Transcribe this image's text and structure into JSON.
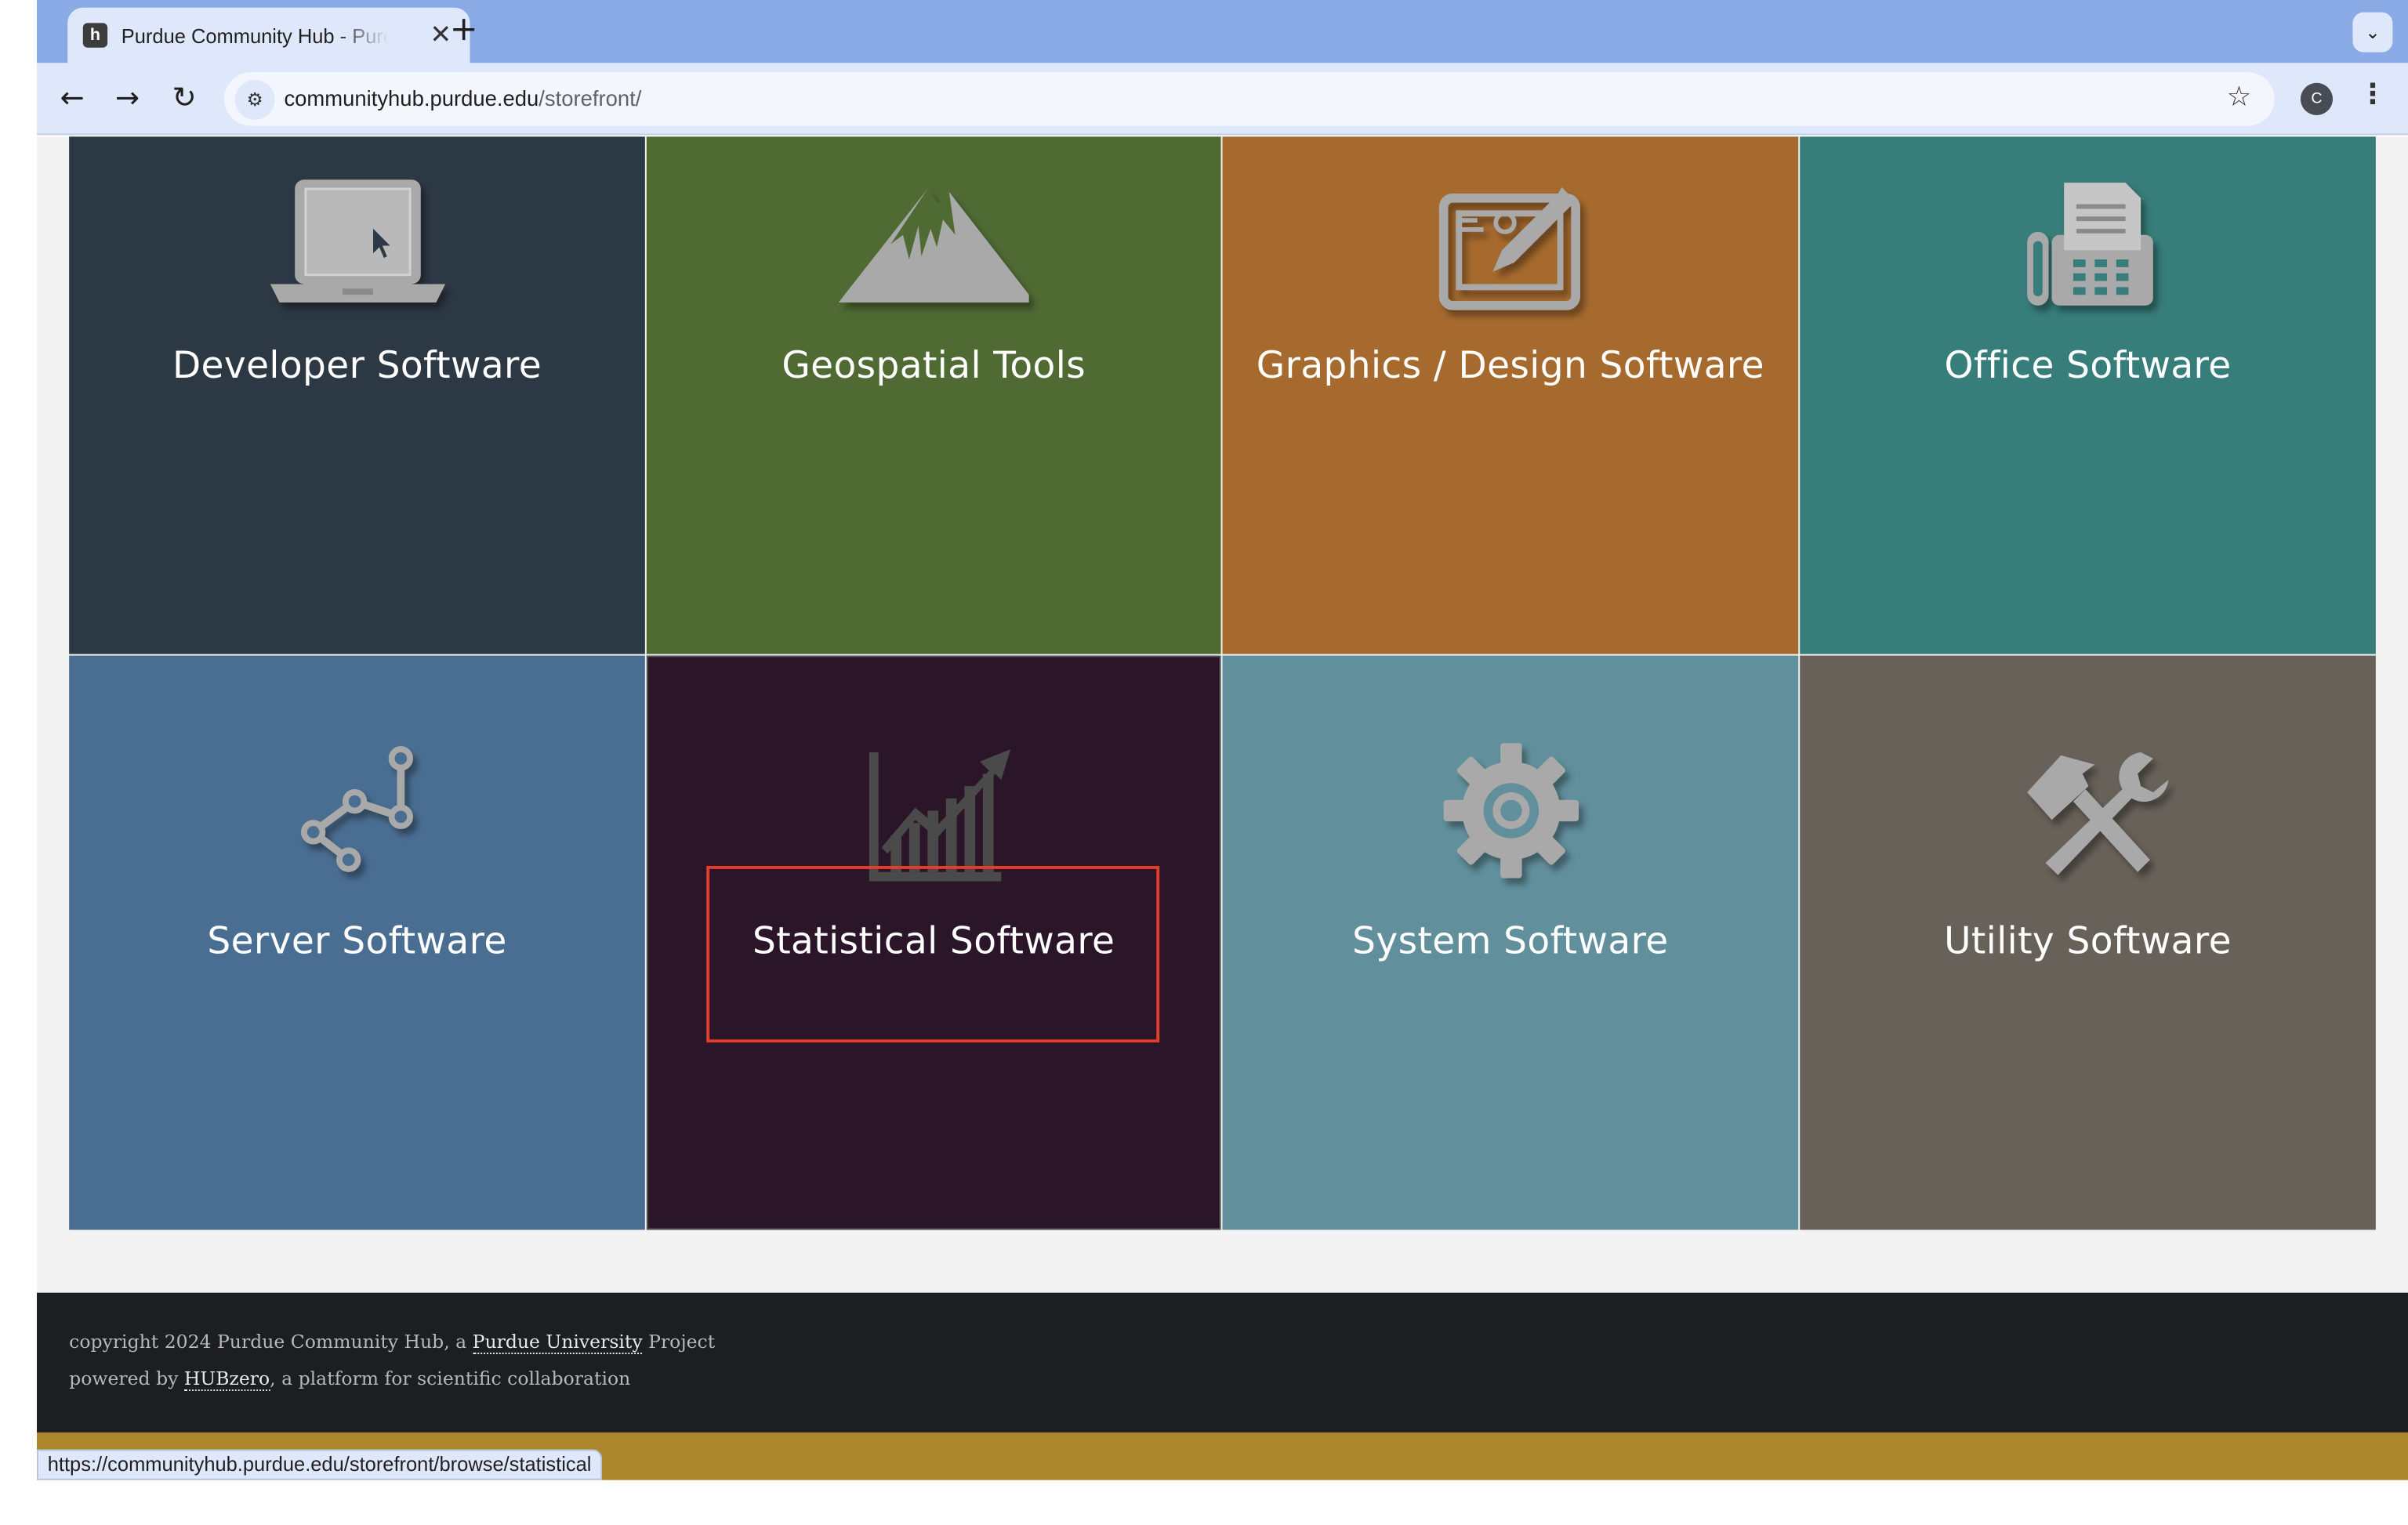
{
  "browser": {
    "tab_title": "Purdue Community Hub - Purdue Community Hub",
    "favicon_letter": "h",
    "close_glyph": "✕",
    "new_tab_glyph": "+",
    "tab_menu_glyph": "⌄",
    "url_host": "communityhub.purdue.edu",
    "url_path": "/storefront/",
    "profile_initial": "C",
    "back_glyph": "←",
    "forward_glyph": "→",
    "reload_glyph": "↻",
    "star_glyph": "☆",
    "menu_glyph": "⋮",
    "site_info_glyph": "⚙"
  },
  "categories": [
    {
      "label": "Developer Software",
      "icon": "laptop-icon",
      "bg": "#2d3845"
    },
    {
      "label": "Geospatial Tools",
      "icon": "mountain-icon",
      "bg": "#4f6a33"
    },
    {
      "label": "Graphics / Design Software",
      "icon": "drawing-tablet-icon",
      "bg": "#a66a2e"
    },
    {
      "label": "Office Software",
      "icon": "fax-machine-icon",
      "bg": "#377d7a"
    },
    {
      "label": "Server Software",
      "icon": "network-nodes-icon",
      "bg": "#4a6e92"
    },
    {
      "label": "Statistical Software",
      "icon": "bar-chart-icon",
      "bg": "#2b1629"
    },
    {
      "label": "System Software",
      "icon": "gear-icon",
      "bg": "#618f9c"
    },
    {
      "label": "Utility Software",
      "icon": "hammer-wrench-icon",
      "bg": "#686159"
    }
  ],
  "footer": {
    "copyright_prefix": "copyright 2024 Purdue Community Hub, a ",
    "copyright_link": "Purdue University",
    "copyright_suffix": " Project",
    "powered_prefix": "powered by ",
    "powered_link": "HUBzero",
    "powered_suffix": ", a platform for scientific collaboration"
  },
  "status_bar": {
    "hover_url": "https://communityhub.purdue.edu/storefront/browse/statistical"
  }
}
